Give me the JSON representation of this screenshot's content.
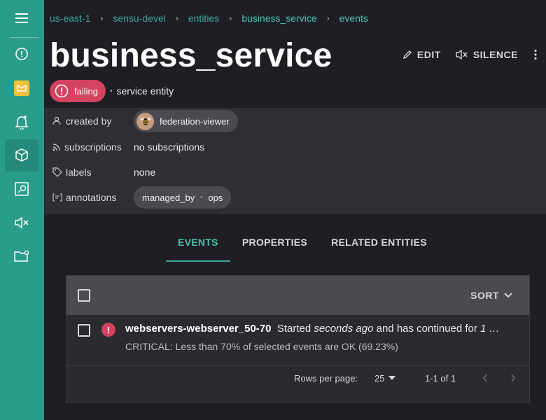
{
  "breadcrumb": [
    "us-east-1",
    "sensu-devel",
    "entities",
    "business_service",
    "events"
  ],
  "page_title": "business_service",
  "toolbar": {
    "edit_label": "EDIT",
    "silence_label": "SILENCE"
  },
  "status": {
    "label": "failing",
    "color": "#d34360"
  },
  "entity_class": "service entity",
  "details": {
    "created_by_label": "created by",
    "created_by_value": "federation-viewer",
    "subscriptions_label": "subscriptions",
    "subscriptions_value": "no subscriptions",
    "labels_label": "labels",
    "labels_value": "none",
    "annotations_label": "annotations",
    "annotation_key": "managed_by",
    "annotation_value": "ops"
  },
  "tabs": [
    "EVENTS",
    "PROPERTIES",
    "RELATED ENTITIES"
  ],
  "list": {
    "sort_label": "SORT",
    "events": [
      {
        "name": "webservers-webserver_50-70",
        "started_prefix": "Started",
        "started_when": "seconds ago",
        "continued_text": "and has continued for",
        "continued_value": "1 …",
        "output": "CRITICAL: Less than 70% of selected events are OK (69.23%)"
      }
    ],
    "pagination": {
      "rows_per_page_label": "Rows per page:",
      "rows_per_page": "25",
      "range": "1-1 of 1"
    }
  },
  "colors": {
    "sidebar": "#2a9d8a",
    "accent": "#4cc0a9",
    "danger": "#d34360"
  },
  "sidebar_icons": [
    "menu-icon",
    "info-icon",
    "namespace-icon",
    "alert-bell-icon",
    "entities-icon",
    "checks-dashboard-icon",
    "silence-icon",
    "config-folder-icon"
  ]
}
